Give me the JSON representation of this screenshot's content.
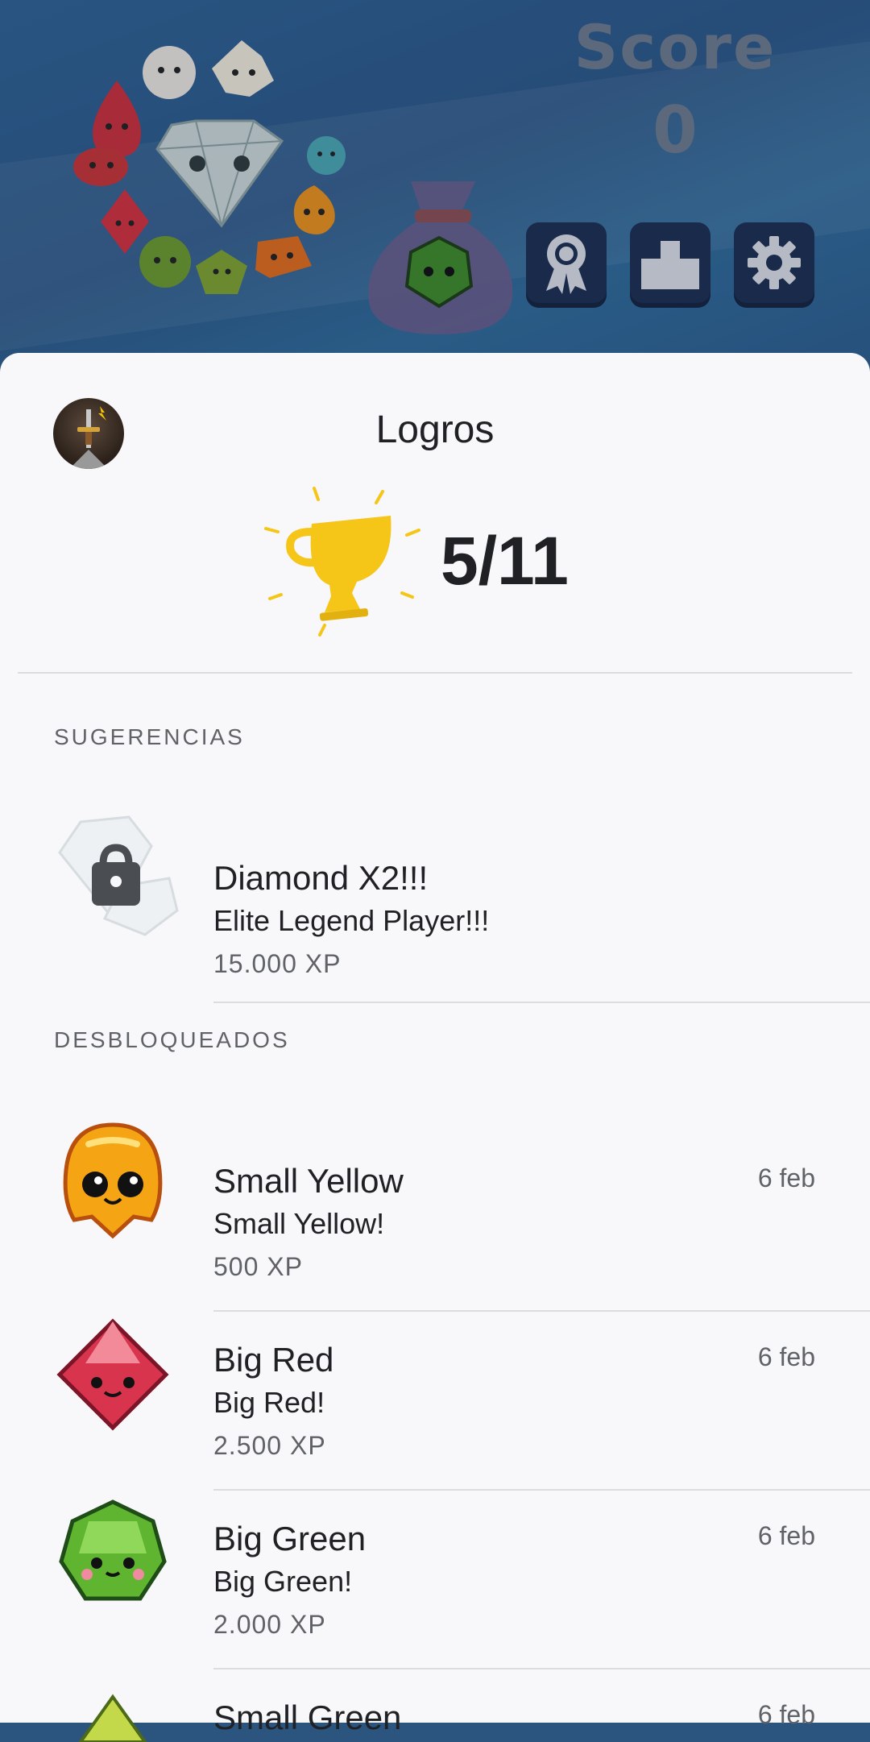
{
  "game": {
    "score_label": "Score",
    "score_value": "0",
    "buttons": [
      {
        "icon": "award-ribbon-icon"
      },
      {
        "icon": "podium-icon"
      },
      {
        "icon": "gear-icon"
      }
    ]
  },
  "sheet": {
    "title": "Logros",
    "avatar_icon": "sword-avatar-icon",
    "trophy_icon": "trophy-icon",
    "count": "5/11",
    "suggestions_heading": "SUGERENCIAS",
    "unlocked_heading": "DESBLOQUEADOS",
    "suggestions": [
      {
        "name": "Diamond X2!!!",
        "desc": "Elite Legend Player!!!",
        "xp": "15.000 XP",
        "icon": "locked-diamond-icon"
      }
    ],
    "unlocked": [
      {
        "name": "Small Yellow",
        "desc": "Small Yellow!",
        "xp": "500 XP",
        "date": "6 feb",
        "icon": "yellow-gem-icon"
      },
      {
        "name": "Big Red",
        "desc": "Big Red!",
        "xp": "2.500 XP",
        "date": "6 feb",
        "icon": "red-gem-icon"
      },
      {
        "name": "Big Green",
        "desc": "Big Green!",
        "xp": "2.000 XP",
        "date": "6 feb",
        "icon": "green-gem-icon"
      },
      {
        "name": "Small Green",
        "desc": "",
        "xp": "",
        "date": "6 feb",
        "icon": "small-green-gem-icon"
      }
    ]
  },
  "colors": {
    "accent_trophy": "#f5c518",
    "text_primary": "#202124",
    "text_secondary": "#5f6368",
    "game_bg": "#2b5788"
  }
}
